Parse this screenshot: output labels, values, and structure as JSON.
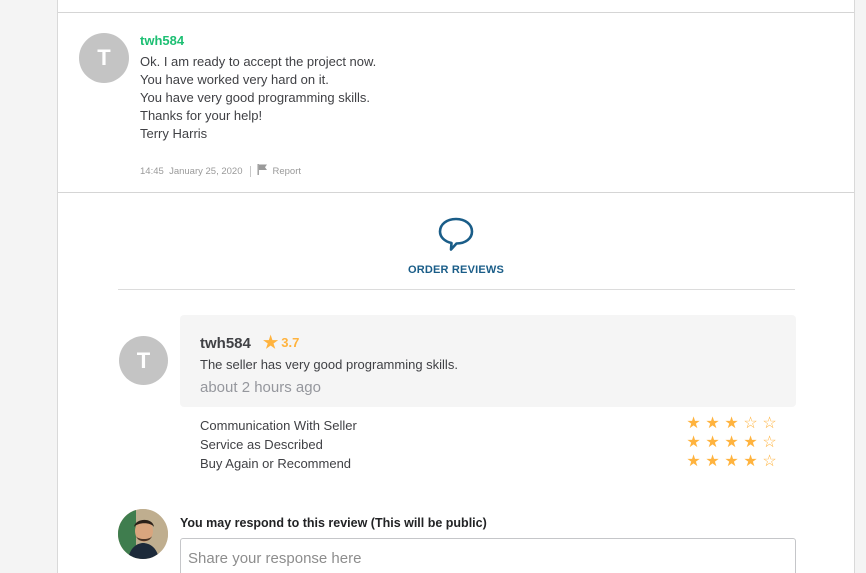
{
  "message": {
    "avatar_letter": "T",
    "username": "twh584",
    "lines": [
      "Ok. I am ready to accept the project now.",
      "You have worked very hard on it.",
      "You have very good programming skills.",
      "Thanks for your help!",
      "Terry Harris"
    ],
    "time": "14:45",
    "date": "January 25, 2020",
    "report_label": "Report"
  },
  "reviews": {
    "title": "ORDER REVIEWS",
    "avatar_letter": "T",
    "username": "twh584",
    "rating": "3.7",
    "text": "The seller has very good programming skills.",
    "time_ago": "about 2 hours ago",
    "criteria": [
      {
        "label": "Communication With Seller",
        "stars": 3
      },
      {
        "label": "Service as Described",
        "stars": 4
      },
      {
        "label": "Buy Again or Recommend",
        "stars": 4
      }
    ],
    "star_max": 5
  },
  "response": {
    "label": "You may respond to this review (This will be public)",
    "placeholder": "Share your response here",
    "value": ""
  },
  "colors": {
    "username_green": "#1dbf73",
    "star": "#ffb33e",
    "reviews_blue": "#1a5d88"
  }
}
